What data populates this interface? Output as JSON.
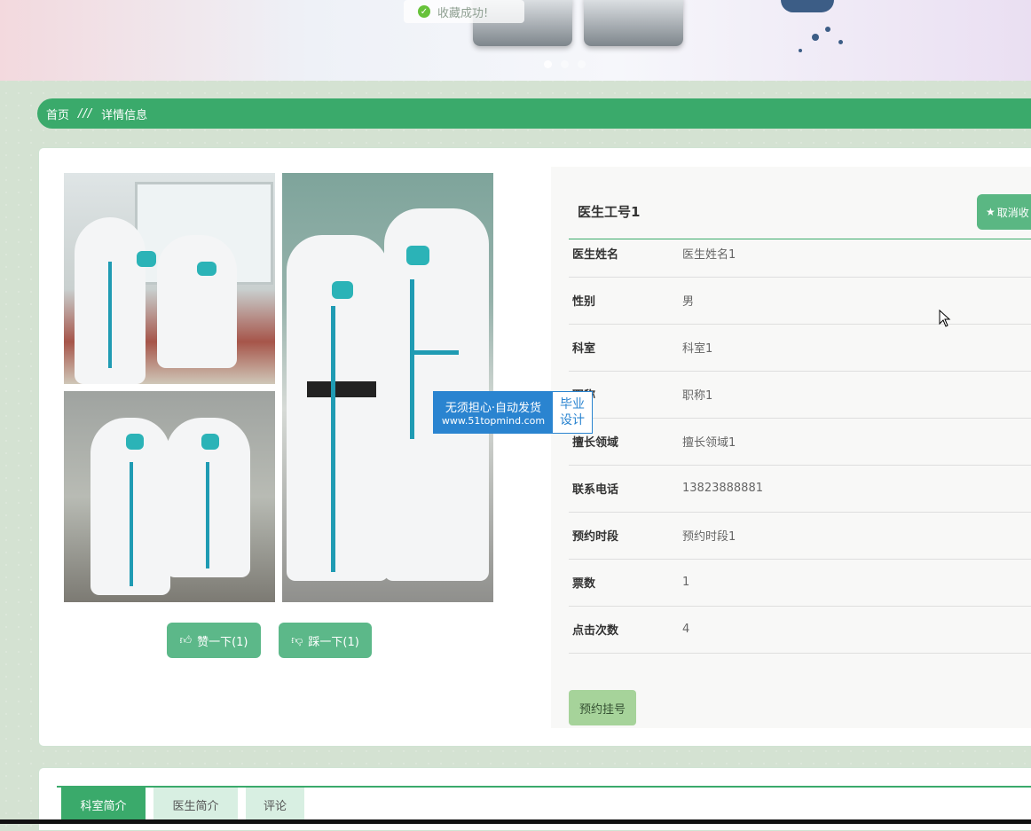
{
  "toast": {
    "text": "收藏成功!"
  },
  "breadcrumb": {
    "home": "首页",
    "separator": "///",
    "current": "详情信息"
  },
  "doctor": {
    "title": "医生工号1",
    "favorite_label": "取消收",
    "fields": [
      {
        "key": "医生姓名",
        "value": "医生姓名1"
      },
      {
        "key": "性别",
        "value": "男"
      },
      {
        "key": "科室",
        "value": "科室1"
      },
      {
        "key": "职称",
        "value": "职称1"
      },
      {
        "key": "擅长领域",
        "value": "擅长领域1"
      },
      {
        "key": "联系电话",
        "value": "13823888881"
      },
      {
        "key": "预约时段",
        "value": "预约时段1"
      },
      {
        "key": "票数",
        "value": "1"
      },
      {
        "key": "点击次数",
        "value": "4"
      }
    ],
    "book_label": "预约挂号"
  },
  "actions": {
    "like_label": "赞一下(1)",
    "dislike_label": "踩一下(1)"
  },
  "watermark": {
    "line1": "无须担心·自动发货",
    "line2": "www.51topmind.com",
    "badge1": "毕业",
    "badge2": "设计"
  },
  "tabs": [
    {
      "label": "科室简介",
      "active": true
    },
    {
      "label": "医生简介",
      "active": false
    },
    {
      "label": "评论",
      "active": false
    }
  ],
  "colors": {
    "primary": "#3aaa6b",
    "button": "#5cb889",
    "book": "#a6d39a",
    "watermark": "#2a84d0"
  },
  "icons": {
    "toast": "check-circle-icon",
    "like": "thumbs-up-icon",
    "dislike": "thumbs-down-icon",
    "favorite": "star-icon"
  }
}
